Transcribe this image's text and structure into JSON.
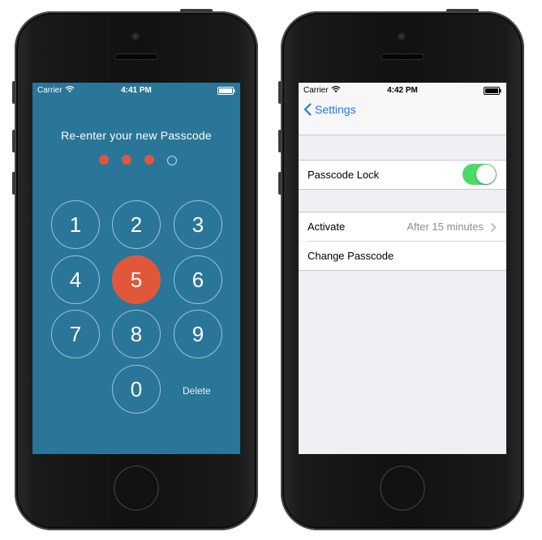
{
  "left_phone": {
    "status": {
      "carrier": "Carrier",
      "time": "4:41 PM"
    },
    "prompt": "Re-enter your new Passcode",
    "entered_count": 3,
    "total_digits": 4,
    "keys": [
      "1",
      "2",
      "3",
      "4",
      "5",
      "6",
      "7",
      "8",
      "9",
      "0"
    ],
    "active_key": "5",
    "delete_label": "Delete",
    "colors": {
      "background": "#2a7698",
      "accent": "#e1573a"
    }
  },
  "right_phone": {
    "status": {
      "carrier": "Carrier",
      "time": "4:42 PM"
    },
    "back_label": "Settings",
    "passcode_lock": {
      "label": "Passcode Lock",
      "enabled": true
    },
    "activate": {
      "label": "Activate",
      "value": "After 15 minutes"
    },
    "change_passcode": {
      "label": "Change Passcode"
    },
    "colors": {
      "tint": "#1a7bf2",
      "toggle_on": "#4cd964"
    }
  }
}
